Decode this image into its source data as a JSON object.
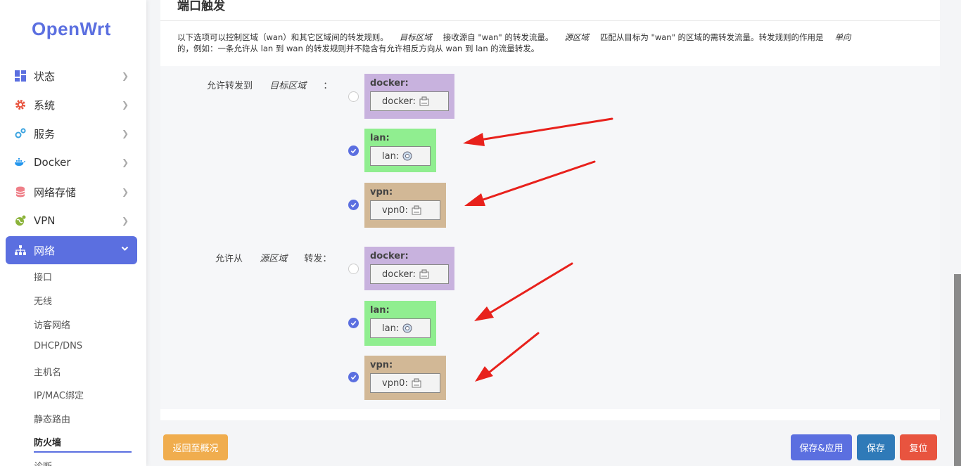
{
  "sidebar": {
    "logo": "OpenWrt",
    "menu": [
      {
        "label": "状态",
        "icon": "dashboard-icon"
      },
      {
        "label": "系统",
        "icon": "gear-icon"
      },
      {
        "label": "服务",
        "icon": "services-icon"
      },
      {
        "label": "Docker",
        "icon": "docker-icon"
      },
      {
        "label": "网络存储",
        "icon": "storage-icon"
      },
      {
        "label": "VPN",
        "icon": "vpn-icon"
      },
      {
        "label": "网络",
        "icon": "network-icon"
      }
    ],
    "submenu": [
      "接口",
      "无线",
      "访客网络",
      "DHCP/DNS",
      "主机名",
      "IP/MAC绑定",
      "静态路由",
      "防火墙",
      "诊断"
    ]
  },
  "section": {
    "title": "端口触发",
    "desc_1": "以下选项可以控制区域（wan）和其它区域间的转发规则。",
    "desc_target": "目标区域",
    "desc_2": "接收源自 \"wan\" 的转发流量。",
    "desc_source": "源区域",
    "desc_3": "匹配从目标为 \"wan\" 的区域的需转发流量。转发规则的作用是",
    "desc_oneway": "单向",
    "desc_4": "的，例如：一条允许从 lan 到 wan 的转发规则并不隐含有允许相反方向从 wan 到 lan 的流量转发。"
  },
  "forward_to": {
    "label_1": "允许转发到",
    "label_em": "目标区域",
    "label_2": "：",
    "zones": [
      {
        "name": "docker:",
        "iface": "docker:",
        "checked": false,
        "color": "#c8b2de"
      },
      {
        "name": "lan:",
        "iface": "lan:",
        "checked": true,
        "color": "#90ee90"
      },
      {
        "name": "vpn:",
        "iface": "vpn0:",
        "checked": true,
        "color": "#d2b896"
      }
    ]
  },
  "forward_from": {
    "label_1": "允许从",
    "label_em": "源区域",
    "label_2": "转发：",
    "zones": [
      {
        "name": "docker:",
        "iface": "docker:",
        "checked": false,
        "color": "#c8b2de"
      },
      {
        "name": "lan:",
        "iface": "lan:",
        "checked": true,
        "color": "#90ee90"
      },
      {
        "name": "vpn:",
        "iface": "vpn0:",
        "checked": true,
        "color": "#d2b896"
      }
    ]
  },
  "buttons": {
    "back": "返回至概况",
    "save_apply": "保存&应用",
    "save": "保存",
    "reset": "复位"
  },
  "colors": {
    "accent": "#5b6fe0",
    "warning": "#f0ad4e",
    "primary": "#2f7ab8",
    "danger": "#e8543f",
    "annotation_arrow": "#e8211c"
  }
}
